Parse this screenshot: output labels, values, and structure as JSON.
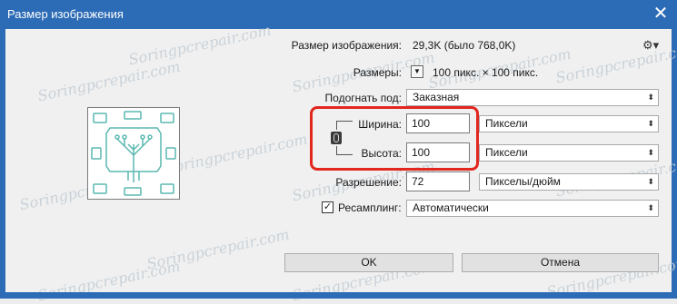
{
  "window": {
    "title": "Размер изображения",
    "close_symbol": "✕"
  },
  "watermark": "Soringpcrepair.com",
  "info": {
    "size_label": "Размер изображения:",
    "size_value": "29,3K (было 768,0K)",
    "dims_label": "Размеры:",
    "dims_value": "100 пикс.  ×  100 пикс."
  },
  "fit": {
    "label": "Подогнать под:",
    "value": "Заказная"
  },
  "width": {
    "label": "Ширина:",
    "value": "100",
    "unit": "Пиксели"
  },
  "height": {
    "label": "Высота:",
    "value": "100",
    "unit": "Пиксели"
  },
  "resolution": {
    "label": "Разрешение:",
    "value": "72",
    "unit": "Пикселы/дюйм"
  },
  "resample": {
    "label": "Ресамплинг:",
    "checked": true,
    "value": "Автоматически"
  },
  "buttons": {
    "ok": "OK",
    "cancel": "Отмена"
  },
  "colors": {
    "accent": "#2c6bb5",
    "highlight": "#e2271f",
    "preview_icon": "#5ab8b0"
  }
}
